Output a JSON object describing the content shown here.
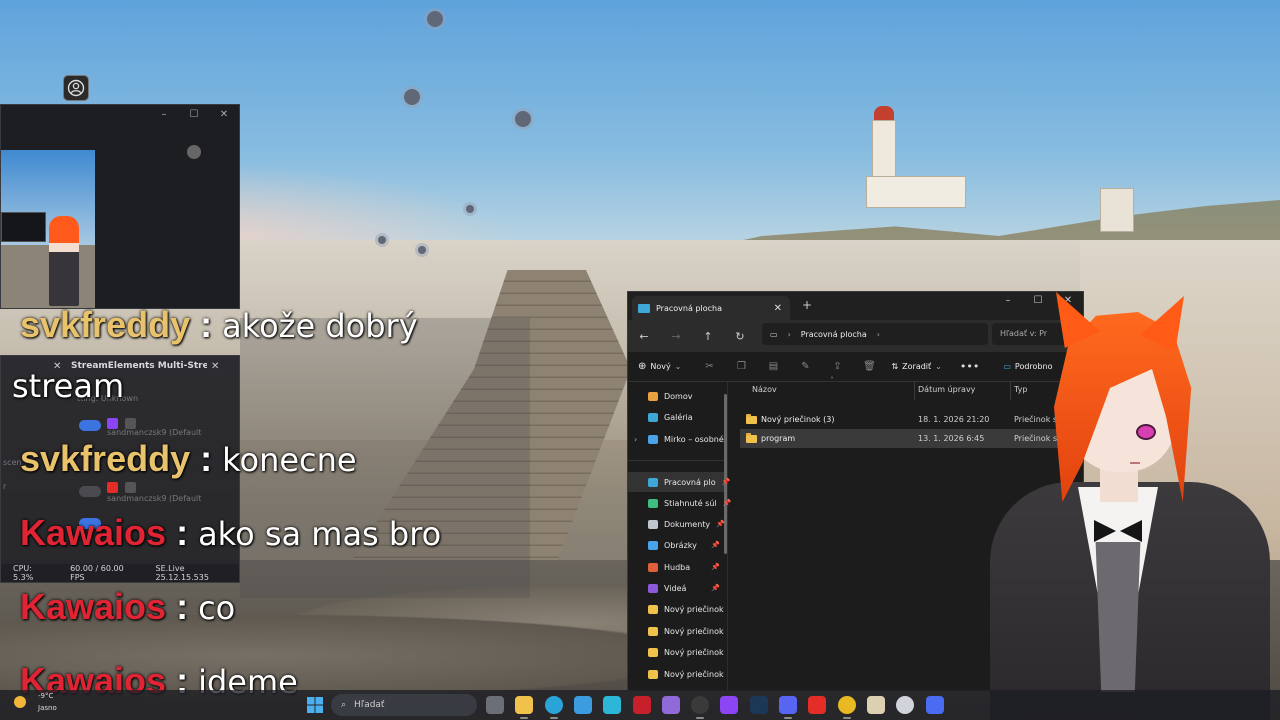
{
  "preview_window": {
    "controls": [
      "–",
      "☐",
      "✕"
    ]
  },
  "multistream_panel": {
    "title": "StreamElements Multi-Strea...",
    "setting_row": "tting: Unknown",
    "destinations": [
      {
        "label": "sandmanczsk9 (Default"
      },
      {
        "label": "sandmanczsk9 (Default"
      }
    ],
    "left_labels": [
      "scen",
      "r"
    ],
    "status": {
      "cpu": "CPU: 5.3%",
      "fps": "60.00 / 60.00 FPS",
      "version": "SE.Live 25.12.15.535"
    }
  },
  "chat": [
    {
      "user": "svkfreddy",
      "message": "akože dobrý",
      "user_color": "#e8c36c"
    },
    {
      "user": "",
      "message": "stream",
      "user_color": ""
    },
    {
      "user": "svkfreddy",
      "message": "konecne",
      "user_color": "#e8c36c"
    },
    {
      "user": "Kawaios",
      "message": "ako sa mas bro",
      "user_color": "#e02434"
    },
    {
      "user": "Kawaios",
      "message": "co",
      "user_color": "#e02434"
    },
    {
      "user": "Kawaios",
      "message": "ideme",
      "user_color": "#e02434"
    }
  ],
  "explorer": {
    "tab_title": "Pracovná plocha",
    "address": "Pracovná plocha",
    "search_placeholder": "Hľadať v: Pr",
    "commands": {
      "new": "Nový",
      "sort": "Zoradiť",
      "details": "Podrobno"
    },
    "nav_pane": [
      {
        "label": "Domov",
        "icon": "home-icon",
        "color": "#e8a040",
        "pinned": false
      },
      {
        "label": "Galéria",
        "icon": "gallery-icon",
        "color": "#3fa7d6",
        "pinned": false
      },
      {
        "label": "Mirko – osobné",
        "icon": "onedrive-icon",
        "color": "#4aa3e8",
        "pinned": false
      },
      {
        "label": "Pracovná plo",
        "icon": "desktop-icon",
        "color": "#3fa7d6",
        "pinned": true
      },
      {
        "label": "Stiahnuté súl",
        "icon": "download-icon",
        "color": "#3fbf7f",
        "pinned": true
      },
      {
        "label": "Dokumenty",
        "icon": "documents-icon",
        "color": "#c0c6d0",
        "pinned": true
      },
      {
        "label": "Obrázky",
        "icon": "pictures-icon",
        "color": "#4aa3e8",
        "pinned": true
      },
      {
        "label": "Hudba",
        "icon": "music-icon",
        "color": "#e0603c",
        "pinned": true
      },
      {
        "label": "Videá",
        "icon": "videos-icon",
        "color": "#8c5ad8",
        "pinned": true
      },
      {
        "label": "Nový priečinok",
        "icon": "folder-icon",
        "color": "#f0c14b",
        "pinned": false
      },
      {
        "label": "Nový priečinok",
        "icon": "folder-icon",
        "color": "#f0c14b",
        "pinned": false
      },
      {
        "label": "Nový priečinok",
        "icon": "folder-icon",
        "color": "#f0c14b",
        "pinned": false
      },
      {
        "label": "Nový priečinok",
        "icon": "folder-icon",
        "color": "#f0c14b",
        "pinned": false
      }
    ],
    "columns": [
      "Názov",
      "Dátum úpravy",
      "Typ"
    ],
    "files": [
      {
        "name": "Nový priečinok (3)",
        "date": "18. 1. 2026 21:20",
        "type": "Priečinok s"
      },
      {
        "name": "program",
        "date": "13. 1. 2026 6:45",
        "type": "Priečinok s"
      }
    ]
  },
  "taskbar": {
    "weather_temp": "-9°C",
    "weather_desc": "Jasno",
    "search_placeholder": "Hľadať",
    "apps": [
      {
        "name": "task-view-icon",
        "color": "#6d6f78"
      },
      {
        "name": "file-explorer-icon",
        "color": "#f0c14b"
      },
      {
        "name": "edge-icon",
        "color": "#2aa3d8"
      },
      {
        "name": "photos-icon",
        "color": "#3b9de0"
      },
      {
        "name": "sticky-app-icon",
        "color": "#2cb6d8"
      },
      {
        "name": "amd-software-icon",
        "color": "#c8202a"
      },
      {
        "name": "vs-icon",
        "color": "#8f6ad8"
      },
      {
        "name": "obs-icon",
        "color": "#3a3a3a"
      },
      {
        "name": "twitch-icon",
        "color": "#8b45f5"
      },
      {
        "name": "steam-icon",
        "color": "#1b3856"
      },
      {
        "name": "discord-icon",
        "color": "#5865f2"
      },
      {
        "name": "youtube-icon",
        "color": "#e52d27"
      },
      {
        "name": "chrome-icon",
        "color": "#e8b923"
      },
      {
        "name": "app-icon",
        "color": "#dcd0b0"
      },
      {
        "name": "streamelements-icon",
        "color": "#d0d4da"
      },
      {
        "name": "app2-icon",
        "color": "#4a6cf0"
      }
    ]
  }
}
